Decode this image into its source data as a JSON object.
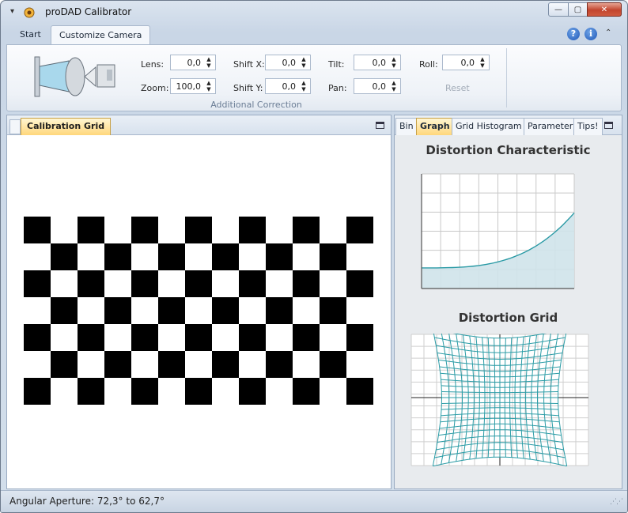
{
  "window": {
    "title": "proDAD Calibrator",
    "qa_menu_glyph": "▾"
  },
  "caption_buttons": {
    "minimize": "—",
    "maximize": "▢",
    "close": "✕"
  },
  "ribbon": {
    "tabs": [
      {
        "label": "Start",
        "active": false
      },
      {
        "label": "Customize Camera",
        "active": true
      }
    ],
    "help_glyph": "?",
    "info_glyph": "i",
    "collapse_glyph": "⌃",
    "group_title": "Additional Correction",
    "fields": {
      "lens": {
        "label": "Lens:",
        "value": "0,0"
      },
      "zoom": {
        "label": "Zoom:",
        "value": "100,0"
      },
      "shift_x": {
        "label": "Shift X:",
        "value": "0,0"
      },
      "shift_y": {
        "label": "Shift Y:",
        "value": "0,0"
      },
      "tilt": {
        "label": "Tilt:",
        "value": "0,0"
      },
      "pan": {
        "label": "Pan:",
        "value": "0,0"
      },
      "roll": {
        "label": "Roll:",
        "value": "0,0"
      }
    },
    "reset_label": "Reset",
    "spin_up": "▲",
    "spin_down": "▼"
  },
  "left_panel": {
    "tab_label": "Calibration Grid"
  },
  "right_panel": {
    "tabs": [
      {
        "label": "Bin",
        "active": false
      },
      {
        "label": "Graph",
        "active": true
      },
      {
        "label": "Grid Histogram",
        "active": false
      },
      {
        "label": "Parameter",
        "active": false
      },
      {
        "label": "Tips!",
        "active": false
      }
    ],
    "characteristic_title": "Distortion Characteristic",
    "grid_title": "Distortion Grid"
  },
  "status": {
    "text": "Angular Aperture: 72,3° to 62,7°",
    "grip": "⋰⋰"
  },
  "colors": {
    "curve": "#2a9aa5",
    "curve_fill": "#cfe3ea",
    "grid_line": "#2c9ca6",
    "active_tab": "#ffd77c",
    "camera_icon_blue": "#a9d8ec"
  }
}
